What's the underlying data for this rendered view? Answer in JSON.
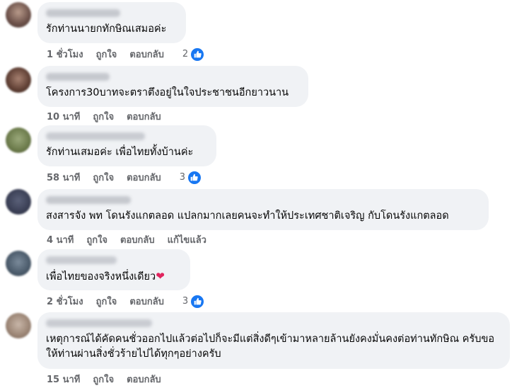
{
  "colors": {
    "bubble": "#f0f2f5",
    "meta": "#65676b",
    "like_blue": "#1877f2"
  },
  "comments": [
    {
      "text": "รักท่านนายกทักษิณเสมอค่ะ",
      "time": "1 ชั่วโมง",
      "like_label": "ถูกใจ",
      "reply_label": "ตอบกลับ",
      "reaction_count": "2",
      "reaction_icon": "thumbs-up-icon"
    },
    {
      "text": "โครงการ30บาทจะตราตึงอยู่ในใจประชาชนอีกยาวนาน",
      "time": "10 นาที",
      "like_label": "ถูกใจ",
      "reply_label": "ตอบกลับ"
    },
    {
      "text": "รักท่านเสมอค่ะ เพื่อไทยทั้งบ้านค่ะ",
      "time": "58 นาที",
      "like_label": "ถูกใจ",
      "reply_label": "ตอบกลับ",
      "reaction_count": "3",
      "reaction_icon": "thumbs-up-icon"
    },
    {
      "text": "สงสารจัง พท โดนรังแกตลอด แปลกมากเลยคนจะทำให้ประเทศชาติเจริญ กับโดนรังแกตลอด",
      "time": "4 นาที",
      "like_label": "ถูกใจ",
      "reply_label": "ตอบกลับ",
      "edited_label": "แก้ไขแล้ว"
    },
    {
      "text": "เพื่อไทยของจริงหนึ่งเดียว",
      "emoji": "❤",
      "time": "2 ชั่วโมง",
      "like_label": "ถูกใจ",
      "reply_label": "ตอบกลับ",
      "reaction_count": "3",
      "reaction_icon": "thumbs-up-icon"
    },
    {
      "text": "เหตุการณ์ได้คัดคนชั่วออกไปแล้วต่อไปก็จะมีแต่สิ่งดีๆเข้ามาหลายล้านยังคงมั่นคงต่อท่านทักษิณ ครับขอให้ท่านผ่านสิ่งชั่วร้ายไปได้ทุกๆอย่างครับ",
      "time": "15 นาที",
      "like_label": "ถูกใจ",
      "reply_label": "ตอบกลับ"
    }
  ]
}
